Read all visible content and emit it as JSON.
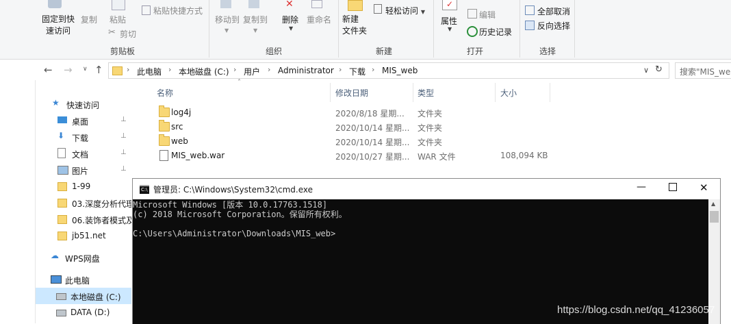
{
  "ribbon": {
    "clipboard": {
      "pin_quick_access": "固定到快速访问",
      "pin_line1": "固定到快",
      "pin_line2": "速访问",
      "copy": "复制",
      "paste": "粘贴",
      "paste_shortcut": "粘贴快捷方式",
      "cut": "剪切",
      "group_label": "剪贴板"
    },
    "organize": {
      "move_to": "移动到",
      "copy_to": "复制到",
      "delete": "删除",
      "rename": "重命名",
      "group_label": "组织"
    },
    "new": {
      "new_folder_line1": "新建",
      "new_folder_line2": "文件夹",
      "easy_access": "轻松访问",
      "group_label": "新建"
    },
    "open": {
      "properties": "属性",
      "edit": "编辑",
      "history": "历史记录",
      "group_label": "打开"
    },
    "select": {
      "select_none": "全部取消",
      "invert_selection": "反向选择",
      "group_label": "选择"
    }
  },
  "address": {
    "crumbs": [
      "此电脑",
      "本地磁盘 (C:)",
      "用户",
      "Administrator",
      "下载",
      "MIS_web"
    ],
    "search_placeholder": "搜索\"MIS_web\""
  },
  "nav": {
    "items": [
      {
        "label": "快速访问",
        "icon": "star-icon",
        "pinned": false
      },
      {
        "label": "桌面",
        "icon": "desktop-icon",
        "pinned": true
      },
      {
        "label": "下载",
        "icon": "download-icon",
        "pinned": true
      },
      {
        "label": "文档",
        "icon": "document-icon",
        "pinned": true
      },
      {
        "label": "图片",
        "icon": "picture-icon",
        "pinned": true
      },
      {
        "label": "1-99",
        "icon": "folder-icon",
        "pinned": false
      },
      {
        "label": "03.深度分析代理",
        "icon": "folder-icon",
        "pinned": false
      },
      {
        "label": "06.装饰者模式及",
        "icon": "folder-icon",
        "pinned": false
      },
      {
        "label": "jb51.net",
        "icon": "folder-icon",
        "pinned": false
      },
      {
        "label": "WPS网盘",
        "icon": "cloud-icon",
        "pinned": false
      },
      {
        "label": "此电脑",
        "icon": "computer-icon",
        "pinned": false
      },
      {
        "label": "本地磁盘 (C:)",
        "icon": "drive-icon",
        "pinned": false,
        "selected": true
      },
      {
        "label": "DATA (D:)",
        "icon": "drive-icon",
        "pinned": false
      }
    ]
  },
  "files": {
    "columns": [
      "名称",
      "修改日期",
      "类型",
      "大小"
    ],
    "rows": [
      {
        "name": "log4j",
        "date": "2020/8/18 星期...",
        "type": "文件夹",
        "size": "",
        "kind": "folder"
      },
      {
        "name": "src",
        "date": "2020/10/14 星期...",
        "type": "文件夹",
        "size": "",
        "kind": "folder"
      },
      {
        "name": "web",
        "date": "2020/10/14 星期...",
        "type": "文件夹",
        "size": "",
        "kind": "folder"
      },
      {
        "name": "MIS_web.war",
        "date": "2020/10/27 星期...",
        "type": "WAR 文件",
        "size": "108,094 KB",
        "kind": "file"
      }
    ]
  },
  "cmd": {
    "title": "管理员: C:\\Windows\\System32\\cmd.exe",
    "lines": [
      "Microsoft Windows [版本 10.0.17763.1518]",
      "(c) 2018 Microsoft Corporation。保留所有权利。",
      "",
      "C:\\Users\\Administrator\\Downloads\\MIS_web>"
    ]
  },
  "watermark": "https://blog.csdn.net/qq_41236057"
}
